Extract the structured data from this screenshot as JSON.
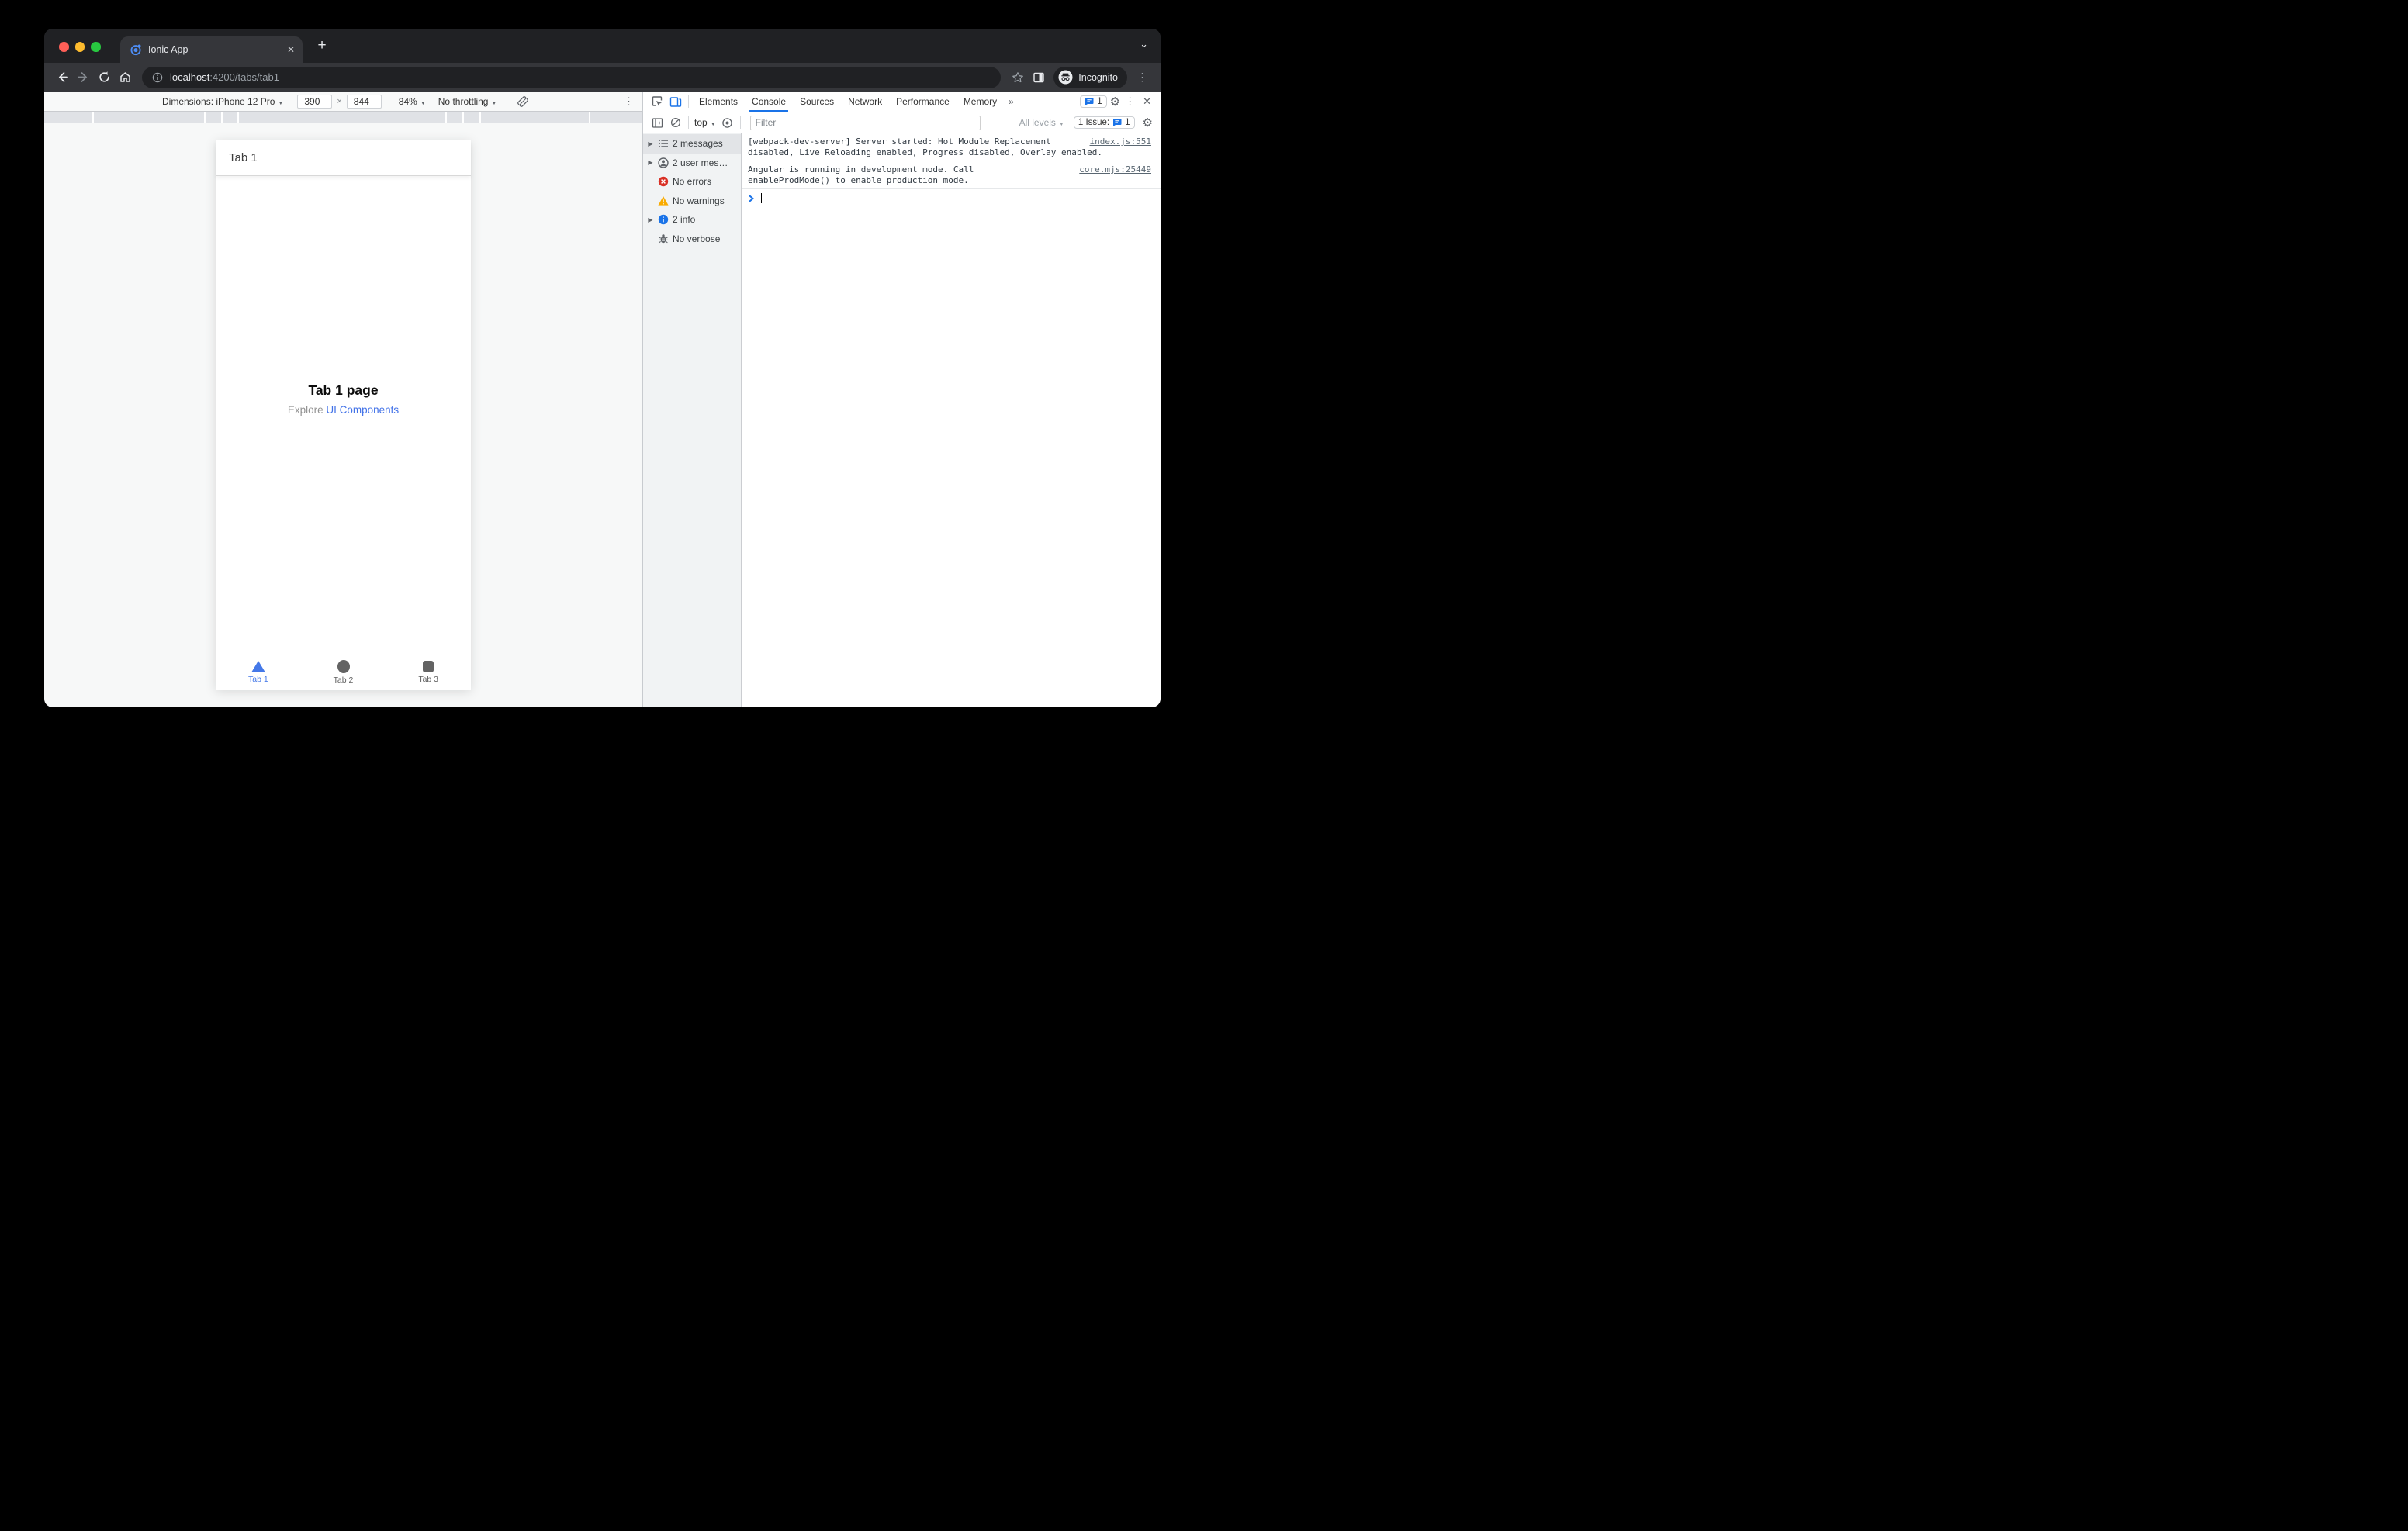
{
  "browser": {
    "tab_title": "Ionic App",
    "close_tab": "✕",
    "new_tab": "+",
    "tab_search": "⌄",
    "url_host": "localhost",
    "url_path": ":4200/tabs/tab1",
    "incognito_label": "Incognito",
    "menu_dots": "⋮"
  },
  "device_toolbar": {
    "dimensions_label": "Dimensions: iPhone 12 Pro",
    "width_value": "390",
    "times": "×",
    "height_value": "844",
    "zoom_value": "84%",
    "throttling_value": "No throttling",
    "caret": "▼",
    "menu_dots": "⋮"
  },
  "devtools": {
    "tabs": [
      "Elements",
      "Console",
      "Sources",
      "Network",
      "Performance",
      "Memory"
    ],
    "more_tabs": "»",
    "tab_issue_count": "1",
    "gear": "⚙",
    "menu_dots": "⋮",
    "close": "✕",
    "console_toolbar": {
      "context": "top",
      "caret": "▼",
      "filter_placeholder": "Filter",
      "levels": "All levels",
      "issue_chip_label": "1 Issue:",
      "issue_chip_count": "1"
    },
    "sidebar": {
      "expander": "▶",
      "items": [
        {
          "label": "2 messages"
        },
        {
          "label": "2 user mes…"
        },
        {
          "label": "No errors"
        },
        {
          "label": "No warnings"
        },
        {
          "label": "2 info"
        },
        {
          "label": "No verbose"
        }
      ]
    },
    "messages": [
      {
        "line1": "[webpack-dev-server] Server started: Hot Module Replacement",
        "line2": "disabled, Live Reloading enabled, Progress disabled, Overlay enabled.",
        "source": "index.js:551"
      },
      {
        "line1": "Angular is running in development mode. Call",
        "line2": "enableProdMode() to enable production mode.",
        "source": "core.mjs:25449"
      }
    ]
  },
  "app": {
    "header_title": "Tab 1",
    "page_title": "Tab 1 page",
    "explore_prefix": "Explore ",
    "explore_link": "UI Components",
    "tabs": [
      {
        "label": "Tab 1"
      },
      {
        "label": "Tab 2"
      },
      {
        "label": "Tab 3"
      }
    ]
  },
  "colors": {
    "accent_blue": "#1a73e8",
    "ionic_blue": "#4478e8",
    "error_red": "#d93025",
    "warning_yellow": "#f9ab00",
    "dark_chrome": "#202124",
    "toolbar_chrome": "#35363a"
  }
}
